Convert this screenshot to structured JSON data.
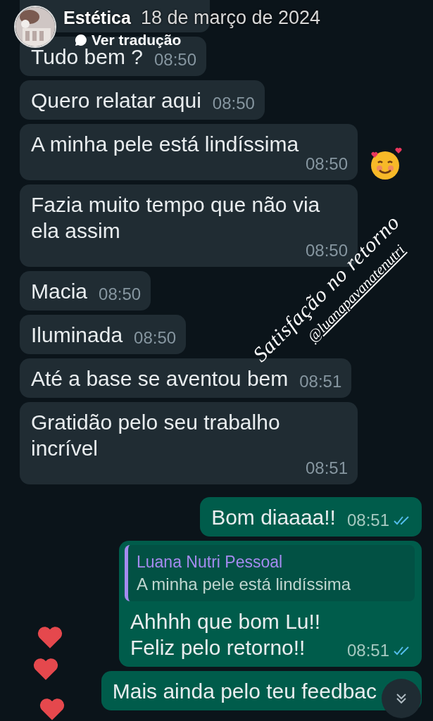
{
  "story_header": {
    "name": "Estética",
    "date": "18 de março de 2024",
    "translate_link": "Ver tradução"
  },
  "messages": [
    {
      "kind": "received",
      "text": "Tudo bem ?",
      "time": "08:50"
    },
    {
      "kind": "received",
      "text": "Quero relatar aqui",
      "time": "08:50"
    },
    {
      "kind": "received",
      "text": "A minha pele está lindíssima",
      "time": "08:50"
    },
    {
      "kind": "received",
      "text": "Fazia muito tempo que não via ela assim",
      "time": "08:50"
    },
    {
      "kind": "received",
      "text": "Macia",
      "time": "08:50"
    },
    {
      "kind": "received",
      "text": "Iluminada",
      "time": "08:50"
    },
    {
      "kind": "received",
      "text": "Até a base se aventou bem",
      "time": "08:51"
    },
    {
      "kind": "received",
      "text": "Gratidão pelo seu trabalho incrível",
      "time": "08:51"
    },
    {
      "kind": "sent",
      "text": "Bom diaaaa!!",
      "time": "08:51",
      "read": true
    },
    {
      "kind": "sent",
      "quote": {
        "author": "Luana Nutri Pessoal",
        "text": "A minha pele está lindíssima"
      },
      "text": "Ahhhh que bom Lu!!\nFeliz pelo retorno!!",
      "time": "08:51",
      "read": true
    },
    {
      "kind": "sent",
      "text": "Mais ainda pelo teu feedbac"
    }
  ],
  "overlay": {
    "caption": "Satisfação no retorno",
    "handle": "@luanapavanatenutri"
  }
}
